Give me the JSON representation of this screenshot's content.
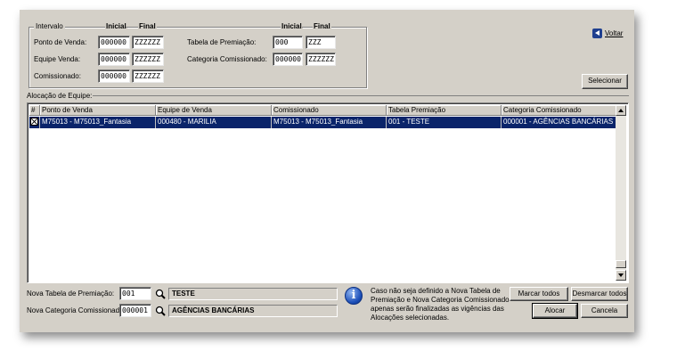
{
  "intervalo": {
    "title": "Intervalo",
    "col_inicial": "Inicial",
    "col_final": "Final",
    "left_rows": [
      {
        "label": "Ponto de Venda:",
        "inicial": "000000",
        "final": "ZZZZZZ"
      },
      {
        "label": "Equipe Venda:",
        "inicial": "000000",
        "final": "ZZZZZZ"
      },
      {
        "label": "Comissionado:",
        "inicial": "000000",
        "final": "ZZZZZZ"
      }
    ],
    "right_rows": [
      {
        "label": "Tabela de Premiação:",
        "inicial": "000",
        "final": "ZZZ"
      },
      {
        "label": "Categoria Comissionado:",
        "inicial": "000000",
        "final": "ZZZZZZ"
      }
    ]
  },
  "voltar_label": "Voltar",
  "selecionar_label": "Selecionar",
  "alocacao": {
    "title": "Alocação de Equipe:",
    "columns": [
      "#",
      "Ponto de Venda",
      "Equipe de Venda",
      "Comissionado",
      "Tabela Premiação",
      "Categoria Comissionado"
    ],
    "rows": [
      {
        "checked": true,
        "ponto": "M75013 - M75013_Fantasia",
        "equipe": "000480 - MARILIA",
        "comissionado": "M75013 - M75013_Fantasia",
        "tabela": "001 - TESTE",
        "categoria": "000001 - AGÊNCIAS BANCÁRIAS"
      }
    ]
  },
  "bottom": {
    "nova_tabela_label": "Nova Tabela de Premiação:",
    "nova_tabela_value": "001",
    "nova_tabela_desc": "TESTE",
    "nova_categoria_label": "Nova Categoria Comissionado:",
    "nova_categoria_value": "000001",
    "nova_categoria_desc": "AGÊNCIAS BANCÁRIAS",
    "info_text": "Caso não seja definido a Nova Tabela de Premiação e Nova Categoria Comissionado apenas serão finalizadas as vigências das Alocações selecionadas.",
    "marcar_todos": "Marcar todos",
    "desmarcar_todos": "Desmarcar todos",
    "alocar": "Alocar",
    "cancela": "Cancela"
  },
  "colors": {
    "window_bg": "#d4d0c8",
    "selection": "#0a246a",
    "icon_blue": "#1f3f8f"
  }
}
